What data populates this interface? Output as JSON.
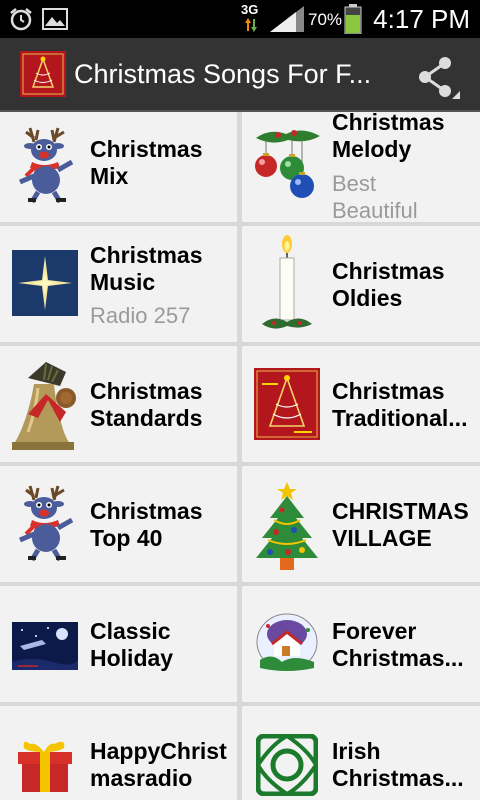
{
  "status_bar": {
    "network": "3G",
    "battery": "70%",
    "time": "4:17 PM"
  },
  "action_bar": {
    "title": "Christmas Songs For F...",
    "share_icon": "share-icon"
  },
  "stations": [
    {
      "line1": "Christmas",
      "line2": "Mix",
      "subtitle": "",
      "icon": "reindeer"
    },
    {
      "line1": "Christmas",
      "line2": "Melody",
      "subtitle_line1": "Best",
      "subtitle_line2": "Beautiful",
      "icon": "ornaments"
    },
    {
      "line1": "Christmas",
      "line2": "Music",
      "subtitle": "Radio 257",
      "icon": "star"
    },
    {
      "line1": "Christmas",
      "line2": "Oldies",
      "subtitle": "",
      "icon": "candle"
    },
    {
      "line1": "Christmas",
      "line2": "Standards",
      "subtitle": "",
      "icon": "bell"
    },
    {
      "line1": "Christmas",
      "line2": "Traditional...",
      "subtitle": "",
      "icon": "merry-christmas-card"
    },
    {
      "line1": "Christmas",
      "line2": "Top 40",
      "subtitle": "",
      "icon": "reindeer"
    },
    {
      "line1": "CHRISTMAS",
      "line2": "VILLAGE",
      "subtitle": "",
      "icon": "christmas-tree"
    },
    {
      "line1": "Classic",
      "line2": "Holiday",
      "subtitle": "",
      "icon": "night-sky"
    },
    {
      "line1": "Forever",
      "line2": "Christmas...",
      "subtitle": "",
      "icon": "snow-globe"
    },
    {
      "line1": "HappyChrist",
      "line2": "masradio",
      "subtitle": "",
      "icon": "gift"
    },
    {
      "line1": "Irish",
      "line2": "Christmas...",
      "subtitle": "",
      "icon": "celtic-knot"
    }
  ]
}
